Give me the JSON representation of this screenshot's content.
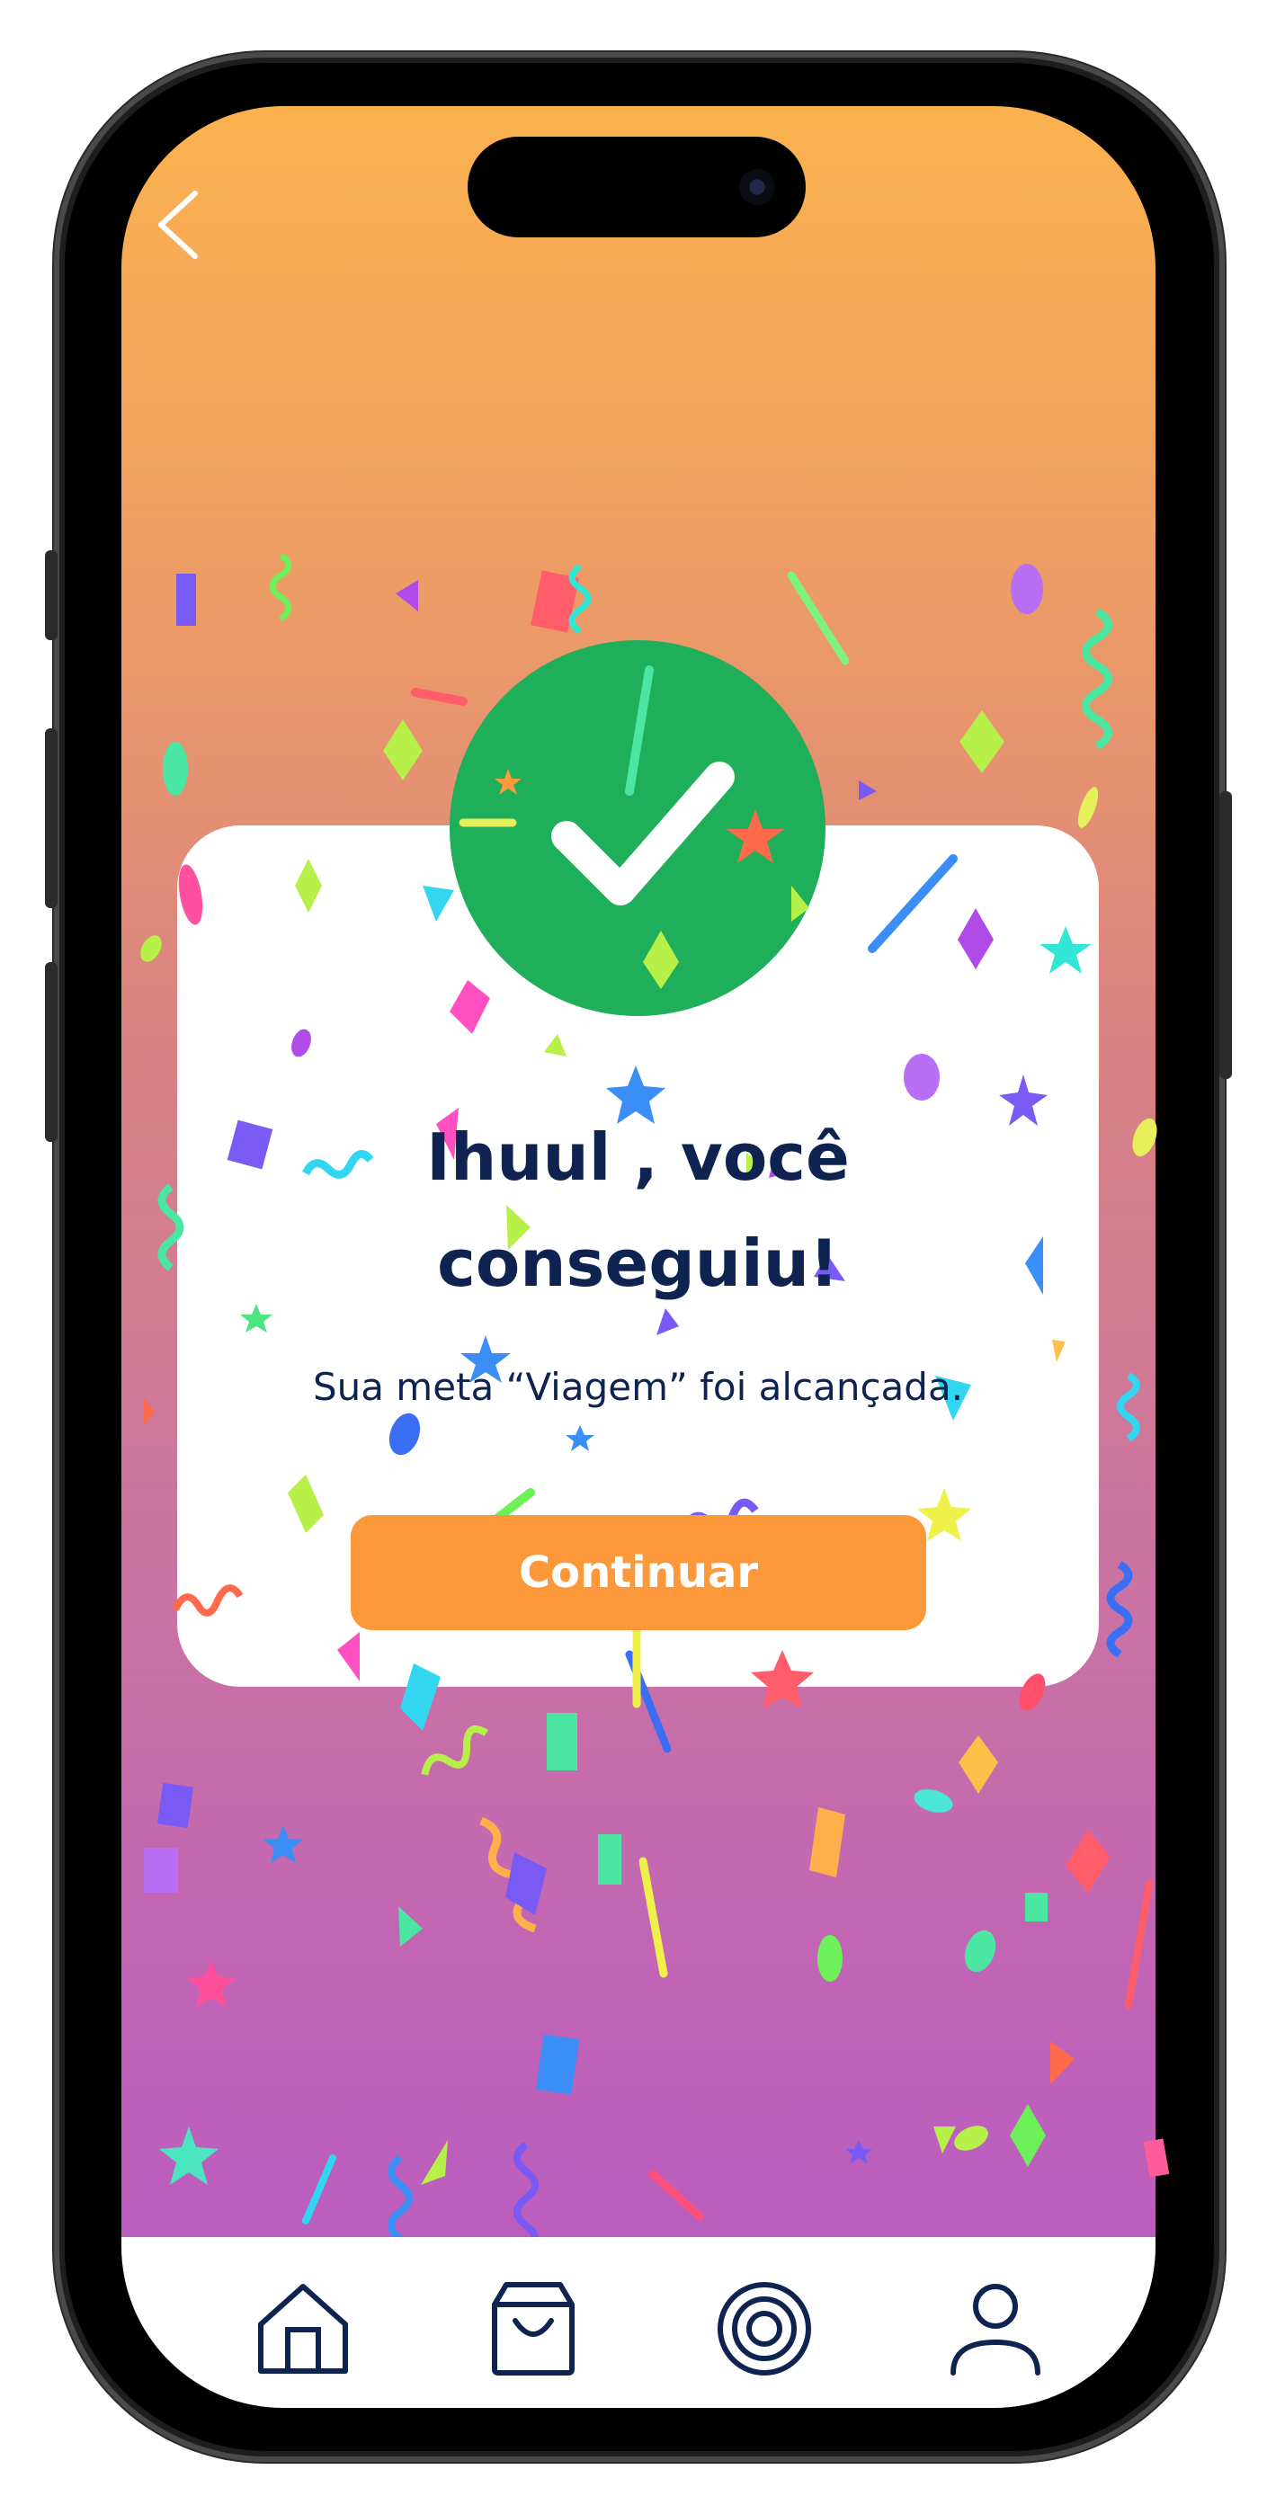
{
  "colors": {
    "gradient_top": "#fbb24e",
    "gradient_bottom": "#b55bc4",
    "card": "#ffffff",
    "success_green": "#1fae5a",
    "title_navy": "#0e2350",
    "button_orange": "#fd983a"
  },
  "header": {
    "back_icon": "chevron-left-icon"
  },
  "success": {
    "icon": "checkmark-circle-icon",
    "title_line1": "Ihuul , você",
    "title_line2": "conseguiu!",
    "message": "Sua meta “Viagem” foi alcançada."
  },
  "actions": {
    "continue_label": "Continuar"
  },
  "tabbar": {
    "items": [
      {
        "icon": "home-icon"
      },
      {
        "icon": "shopping-bag-icon"
      },
      {
        "icon": "target-icon"
      },
      {
        "icon": "profile-icon"
      }
    ]
  }
}
